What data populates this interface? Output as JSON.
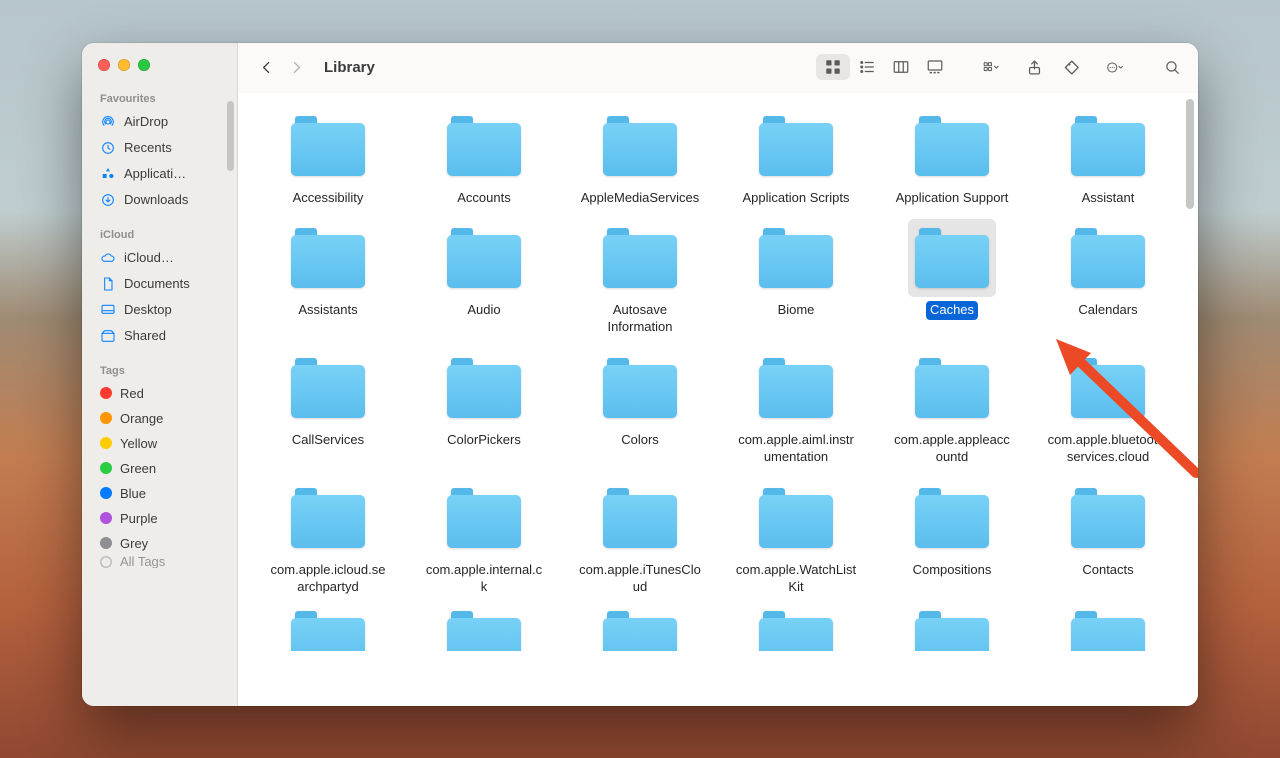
{
  "windowTitle": "Library",
  "sidebar": {
    "favourites": {
      "title": "Favourites",
      "items": [
        {
          "label": "AirDrop",
          "icon": "airdrop"
        },
        {
          "label": "Recents",
          "icon": "clock"
        },
        {
          "label": "Applicati…",
          "icon": "apps"
        },
        {
          "label": "Downloads",
          "icon": "download"
        }
      ]
    },
    "icloud": {
      "title": "iCloud",
      "items": [
        {
          "label": "iCloud…",
          "icon": "cloud"
        },
        {
          "label": "Documents",
          "icon": "doc"
        },
        {
          "label": "Desktop",
          "icon": "desktop"
        },
        {
          "label": "Shared",
          "icon": "shared"
        }
      ]
    },
    "tags": {
      "title": "Tags",
      "items": [
        {
          "label": "Red",
          "color": "#ff3b30"
        },
        {
          "label": "Orange",
          "color": "#ff9500"
        },
        {
          "label": "Yellow",
          "color": "#ffcc00"
        },
        {
          "label": "Green",
          "color": "#28cd41"
        },
        {
          "label": "Blue",
          "color": "#007aff"
        },
        {
          "label": "Purple",
          "color": "#af52de"
        },
        {
          "label": "Grey",
          "color": "#8e8e93"
        },
        {
          "label": "All Tags",
          "color": "outline"
        }
      ]
    }
  },
  "folders": [
    "Accessibility",
    "Accounts",
    "AppleMediaServices",
    "Application Scripts",
    "Application Support",
    "Assistant",
    "Assistants",
    "Audio",
    "Autosave Information",
    "Biome",
    "Caches",
    "Calendars",
    "CallServices",
    "ColorPickers",
    "Colors",
    "com.apple.aiml.instrumentation",
    "com.apple.appleaccountd",
    "com.apple.bluetooth.services.cloud",
    "com.apple.icloud.searchpartyd",
    "com.apple.internal.ck",
    "com.apple.iTunesCloud",
    "com.apple.WatchListKit",
    "Compositions",
    "Contacts",
    "",
    "",
    "",
    "",
    "",
    ""
  ],
  "selected": "Caches",
  "annotation": "arrow-to-caches"
}
